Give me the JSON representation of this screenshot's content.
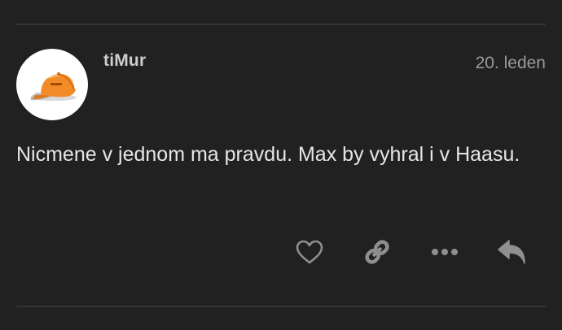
{
  "post": {
    "author": "tiMur",
    "date": "20. leden",
    "body": "Nicmene v jednom ma pravdu. Max by vyhral i v Haasu.",
    "avatar": {
      "icon": "orange-cap-icon",
      "background": "#ffffff",
      "accent": "#f28c28"
    }
  },
  "actions": [
    {
      "name": "like",
      "icon": "heart-icon"
    },
    {
      "name": "copy-link",
      "icon": "link-icon"
    },
    {
      "name": "more",
      "icon": "ellipsis-icon"
    },
    {
      "name": "reply",
      "icon": "reply-icon"
    }
  ],
  "colors": {
    "background": "#212121",
    "text": "#e6e6e6",
    "muted": "#9a9a9a",
    "icon": "#8f8f8f",
    "divider": "#343434"
  }
}
